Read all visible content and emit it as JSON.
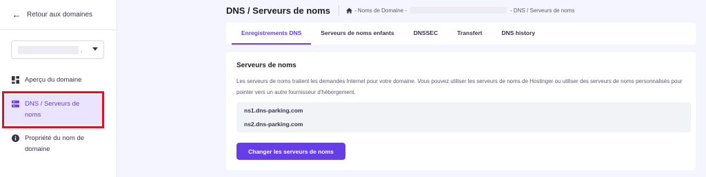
{
  "sidebar": {
    "back_label": "Retour aux domaines",
    "domain_select_suffix": ".",
    "items": [
      {
        "label": "Aperçu du domaine",
        "icon": "dashboard-icon"
      },
      {
        "label": "DNS / Serveurs de noms",
        "icon": "server-icon",
        "active": true
      },
      {
        "label": "Propriété du nom de domaine",
        "icon": "info-icon"
      }
    ]
  },
  "header": {
    "title": "DNS / Serveurs de noms",
    "breadcrumb": {
      "part1": "- Noms de Domaine -",
      "part2": "- DNS / Serveurs de noms"
    }
  },
  "tabs": [
    {
      "label": "Enregistrements DNS",
      "active": true
    },
    {
      "label": "Serveurs de noms enfants"
    },
    {
      "label": "DNSSEC"
    },
    {
      "label": "Transfert"
    },
    {
      "label": "DNS history"
    }
  ],
  "card": {
    "title": "Serveurs de noms",
    "description": "Les serveurs de noms traitent les demandes Internet pour votre domaine. Vous pouvez utiliser les serveurs de noms de Hostinger ou utiliser des serveurs de noms personnalisés pour pointer vers un autre fournisseur d'hébergement.",
    "nameservers": [
      "ns1.dns-parking.com",
      "ns2.dns-parking.com"
    ],
    "button_label": "Changer les serveurs de noms"
  },
  "colors": {
    "accent": "#673de6",
    "active_bg": "#ebe4ff",
    "background": "#f4f5ff",
    "highlight_border": "#e01020"
  }
}
